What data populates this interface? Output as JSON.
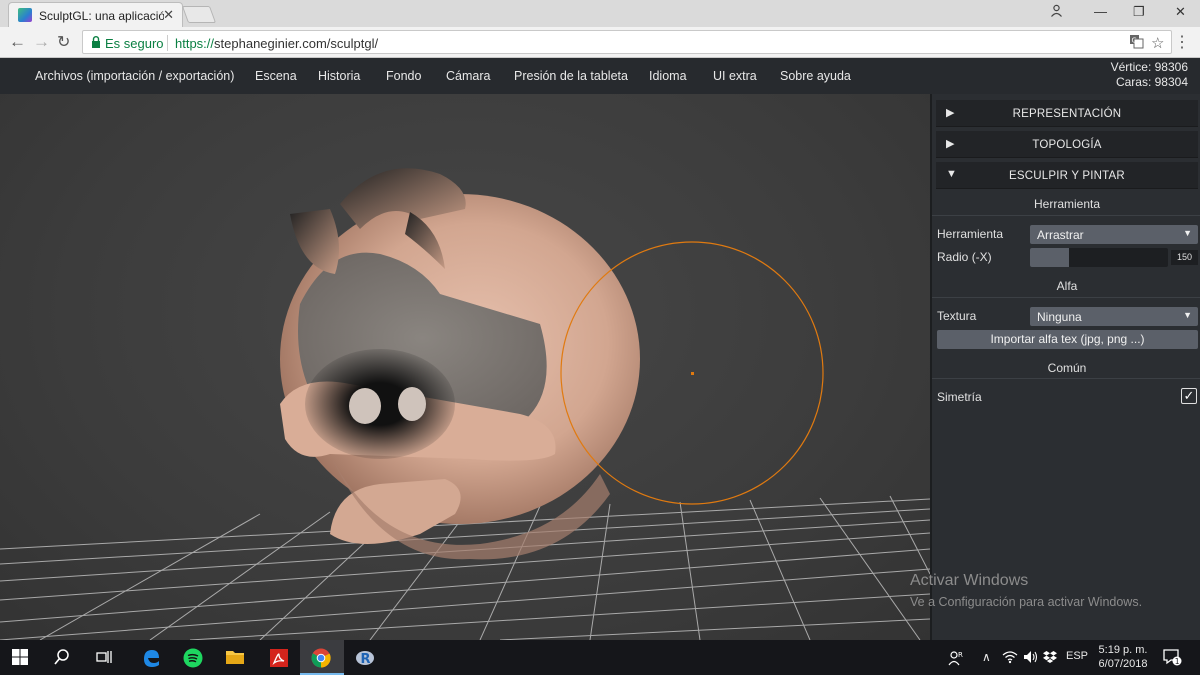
{
  "browser": {
    "tab_title": "SculptGL: una aplicación",
    "secure_label": "Es seguro",
    "url_scheme": "https://",
    "url_rest": "stephaneginier.com/sculptgl/"
  },
  "menubar": {
    "items": [
      "Archivos (importación / exportación)",
      "Escena",
      "Historia",
      "Fondo",
      "Cámara",
      "Presión de la tableta",
      "Idioma",
      "UI extra",
      "Sobre ayuda"
    ],
    "stats_vertices": "Vértice: 98306",
    "stats_faces": "Caras: 98304"
  },
  "panel": {
    "sections": [
      {
        "label": "REPRESENTACIÓN",
        "expanded": false
      },
      {
        "label": "TOPOLOGÍA",
        "expanded": false
      },
      {
        "label": "ESCULPIR Y PINTAR",
        "expanded": true
      }
    ],
    "tool_heading": "Herramienta",
    "tool_label": "Herramienta",
    "tool_value": "Arrastrar",
    "radius_label": "Radio (-X)",
    "radius_value": "150",
    "radius_fraction": 0.28,
    "alpha_heading": "Alfa",
    "texture_label": "Textura",
    "texture_value": "Ninguna",
    "import_button": "Importar alfa tex (jpg, png ...)",
    "common_heading": "Común",
    "symmetry_label": "Simetría",
    "symmetry_checked": true
  },
  "watermark": {
    "line1": "Activar Windows",
    "line2": "Ve a Configuración para activar Windows."
  },
  "taskbar": {
    "language": "ESP",
    "time": "5:19 p. m.",
    "date": "6/07/2018",
    "notification_count": "1"
  },
  "colors": {
    "brush_ring": "#e07a10",
    "panel_bg": "#2b2e32",
    "accent_taskbar": "#76b9ed"
  }
}
